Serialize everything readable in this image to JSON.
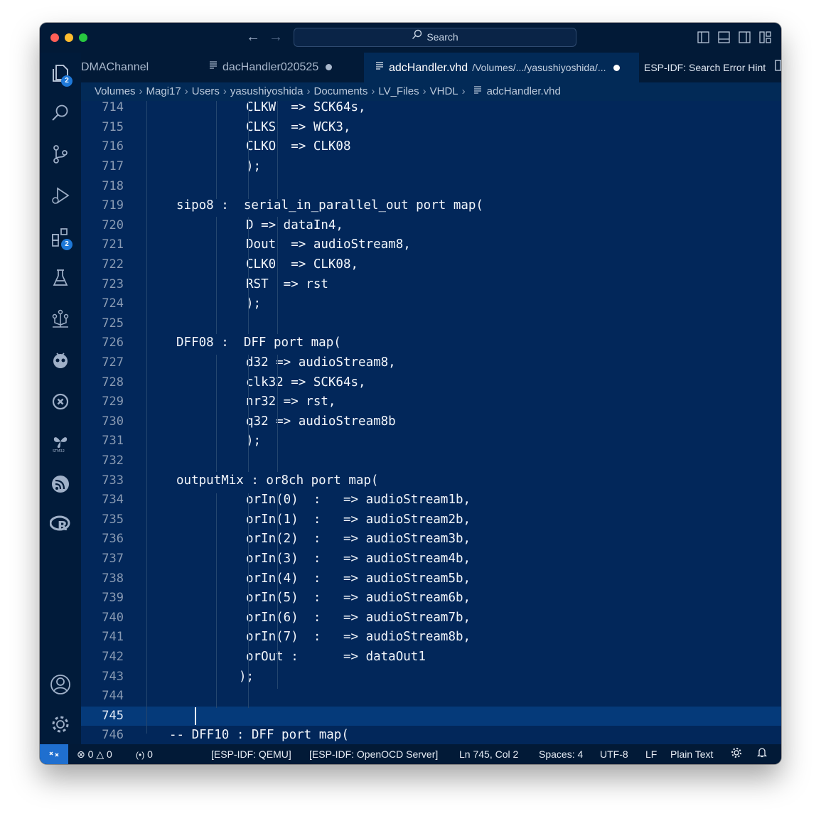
{
  "titlebar": {
    "search_placeholder": "Search"
  },
  "activity_bar": {
    "explorer_badge": "2",
    "extensions_badge": "2"
  },
  "tabs": [
    {
      "label": "DMAChannel",
      "dirty": false,
      "active": false
    },
    {
      "label": "dacHandler020525",
      "dirty": true,
      "active": false
    },
    {
      "label": "adcHandler.vhd",
      "description": "/Volumes/.../yasushiyoshida/...",
      "dirty": true,
      "active": true
    },
    {
      "label": "ESP-IDF: Search Error Hint",
      "dirty": false,
      "active": false
    }
  ],
  "breadcrumb": [
    "Volumes",
    "Magi17",
    "Users",
    "yasushiyoshida",
    "Documents",
    "LV_Files",
    "VHDL",
    "adcHandler.vhd"
  ],
  "editor": {
    "current_line": "745",
    "lines": [
      {
        "n": "714",
        "text": "CLKW  => SCK64s,"
      },
      {
        "n": "715",
        "text": "CLKS  => WCK3,"
      },
      {
        "n": "716",
        "text": "CLKO  => CLK08"
      },
      {
        "n": "717",
        "text": ");"
      },
      {
        "n": "718",
        "text": ""
      },
      {
        "n": "719",
        "text": "sipo8 :  serial_in_parallel_out port map("
      },
      {
        "n": "720",
        "text": "D => dataIn4,"
      },
      {
        "n": "721",
        "text": "Dout  => audioStream8,"
      },
      {
        "n": "722",
        "text": "CLK0  => CLK08,"
      },
      {
        "n": "723",
        "text": "RST  => rst"
      },
      {
        "n": "724",
        "text": ");"
      },
      {
        "n": "725",
        "text": ""
      },
      {
        "n": "726",
        "text": "DFF08 :  DFF port map("
      },
      {
        "n": "727",
        "text": "d32 => audioStream8,"
      },
      {
        "n": "728",
        "text": "clk32 => SCK64s,"
      },
      {
        "n": "729",
        "text": "nr32 => rst,"
      },
      {
        "n": "730",
        "text": "q32 => audioStream8b"
      },
      {
        "n": "731",
        "text": ");"
      },
      {
        "n": "732",
        "text": ""
      },
      {
        "n": "733",
        "text": "outputMix : or8ch port map("
      },
      {
        "n": "734",
        "text": "orIn(0)  :   => audioStream1b,"
      },
      {
        "n": "735",
        "text": "orIn(1)  :   => audioStream2b,"
      },
      {
        "n": "736",
        "text": "orIn(2)  :   => audioStream3b,"
      },
      {
        "n": "737",
        "text": "orIn(3)  :   => audioStream4b,"
      },
      {
        "n": "738",
        "text": "orIn(4)  :   => audioStream5b,"
      },
      {
        "n": "739",
        "text": "orIn(5)  :   => audioStream6b,"
      },
      {
        "n": "740",
        "text": "orIn(6)  :   => audioStream7b,"
      },
      {
        "n": "741",
        "text": "orIn(7)  :   => audioStream8b,"
      },
      {
        "n": "742",
        "text": "orOut :      => dataOut1"
      },
      {
        "n": "743",
        "text": ");"
      },
      {
        "n": "744",
        "text": ""
      },
      {
        "n": "745",
        "text": ""
      },
      {
        "n": "746",
        "text": "-- DFF10 : DFF port map("
      }
    ]
  },
  "statusbar": {
    "errors": "0",
    "warnings": "0",
    "ports": "0",
    "qemu": "[ESP-IDF: QEMU]",
    "openocd": "[ESP-IDF: OpenOCD Server]",
    "cursor_pos": "Ln 745, Col 2",
    "spaces": "Spaces: 4",
    "encoding": "UTF-8",
    "eol": "LF",
    "language": "Plain Text"
  }
}
